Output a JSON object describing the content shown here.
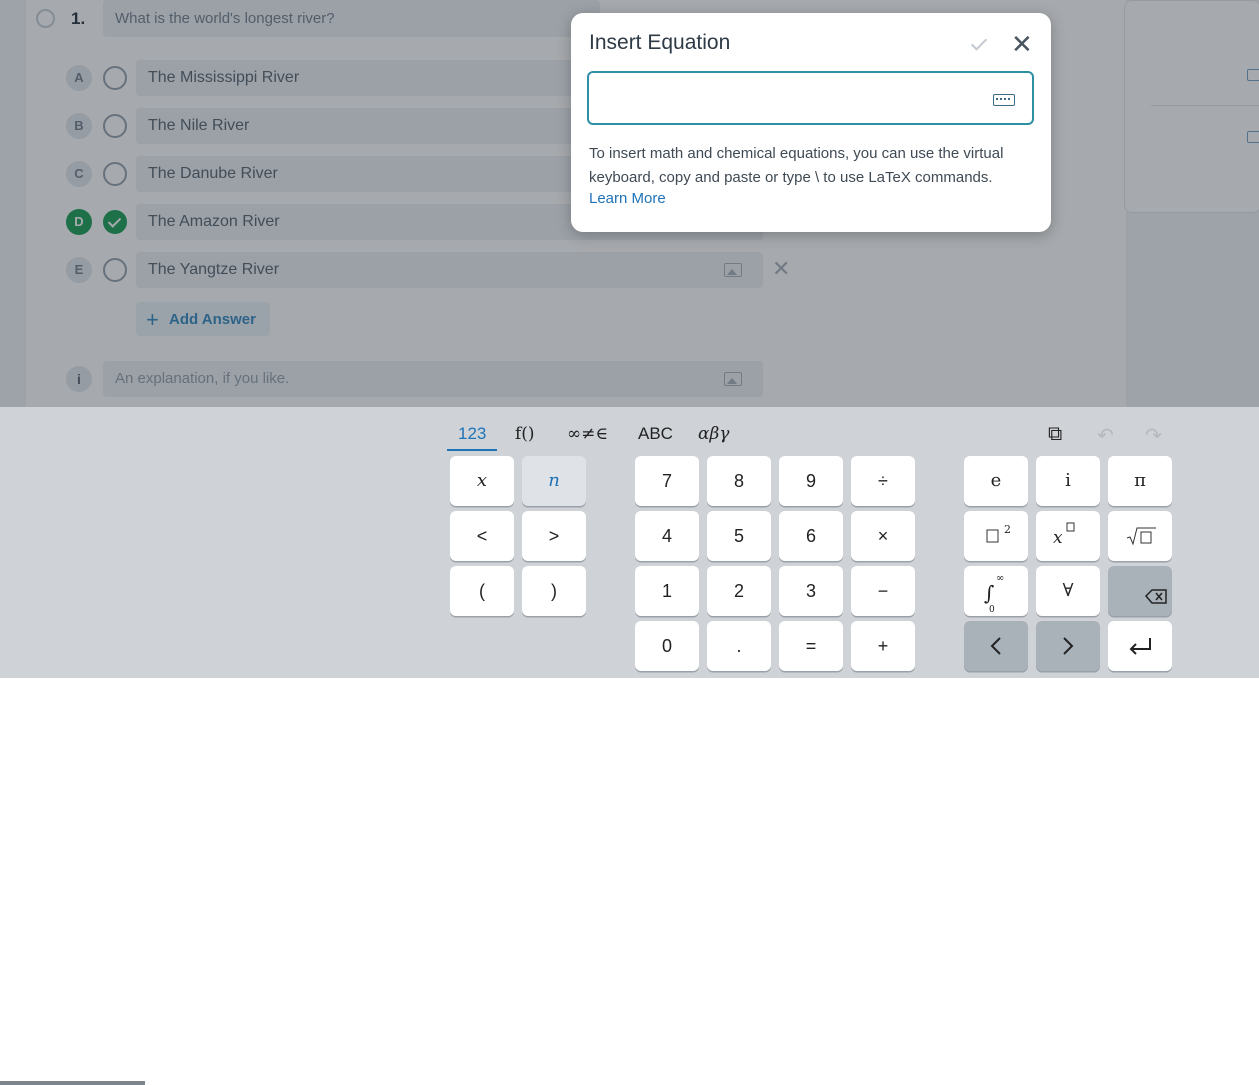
{
  "question": {
    "number": "1.",
    "text": "What is the world's longest river?"
  },
  "answers": [
    {
      "letter": "A",
      "text": "The Mississippi River",
      "correct": false
    },
    {
      "letter": "B",
      "text": "The Nile River",
      "correct": false
    },
    {
      "letter": "C",
      "text": "The Danube River",
      "correct": false
    },
    {
      "letter": "D",
      "text": "The Amazon River",
      "correct": true
    },
    {
      "letter": "E",
      "text": "The Yangtze River",
      "correct": false
    }
  ],
  "add_answer_label": "Add Answer",
  "explanation": {
    "marker": "i",
    "placeholder": "An explanation, if you like."
  },
  "modal": {
    "title": "Insert Equation",
    "help_text": "To insert math and chemical equations, you can use the virtual keyboard, copy and paste or type \\ to use LaTeX commands.",
    "learn_more": "Learn More"
  },
  "keyboard": {
    "tabs": [
      "123",
      "f()",
      "∞≠∈",
      "ABC",
      "αβγ"
    ],
    "active_tab": "123",
    "toolbar_icons": [
      "copy-icon",
      "undo-icon",
      "redo-icon"
    ],
    "vars": [
      "x",
      "n",
      "<",
      ">",
      "(",
      ")"
    ],
    "digits": [
      "7",
      "8",
      "9",
      "÷",
      "4",
      "5",
      "6",
      "×",
      "1",
      "2",
      "3",
      "−",
      "0",
      ".",
      "=",
      "+"
    ],
    "functions": [
      "e",
      "i",
      "π",
      "∀"
    ]
  },
  "colors": {
    "accent": "#2f8fa3",
    "link": "#1f73b7",
    "correct": "#22a45d",
    "keyboard_bg": "#cfd3d8"
  }
}
